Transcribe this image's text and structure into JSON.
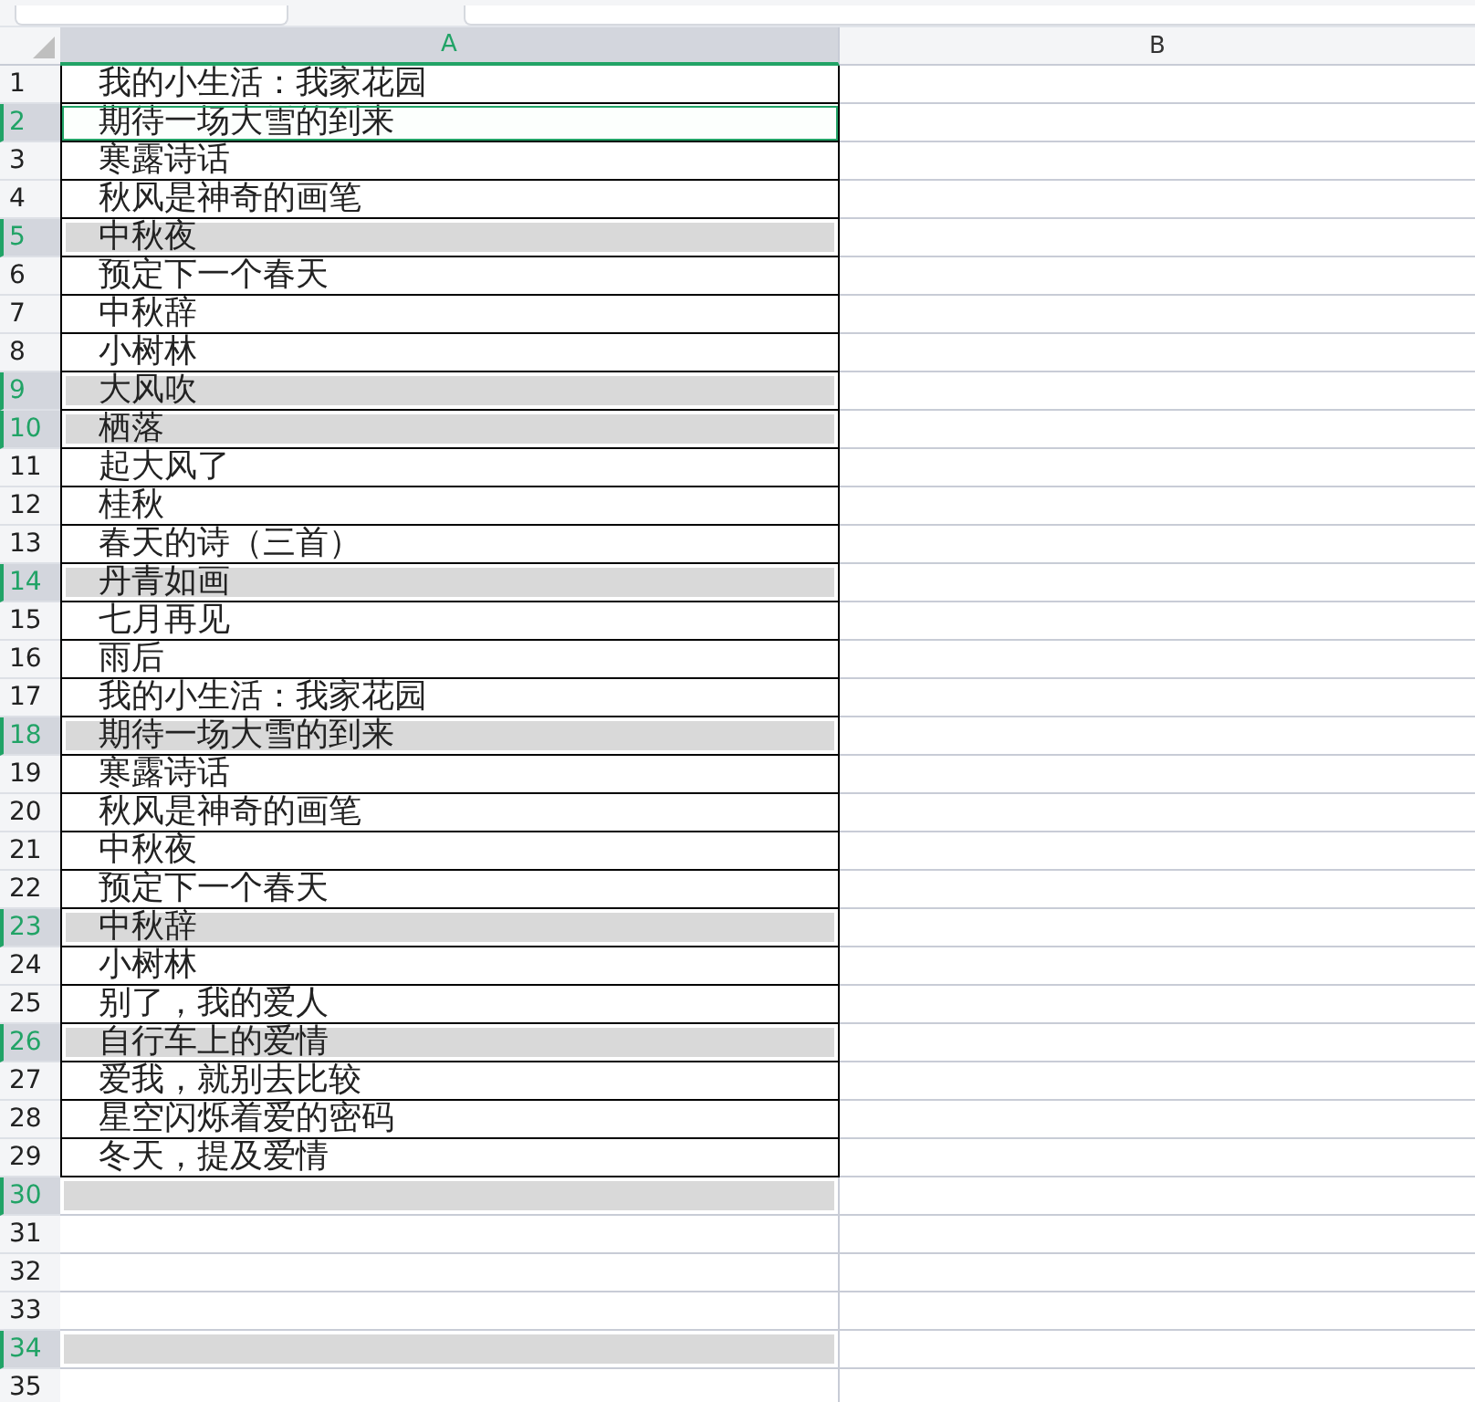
{
  "columns": [
    {
      "label": "A",
      "selected": true
    },
    {
      "label": "B",
      "selected": false
    }
  ],
  "rows": [
    {
      "number": "1",
      "text": "我的小生活：我家花园",
      "selected": false,
      "active": false
    },
    {
      "number": "2",
      "text": "期待一场大雪的到来",
      "selected": true,
      "active": true
    },
    {
      "number": "3",
      "text": "寒露诗话",
      "selected": false,
      "active": false
    },
    {
      "number": "4",
      "text": "秋风是神奇的画笔",
      "selected": false,
      "active": false
    },
    {
      "number": "5",
      "text": "中秋夜",
      "selected": true,
      "active": false
    },
    {
      "number": "6",
      "text": "预定下一个春天",
      "selected": false,
      "active": false
    },
    {
      "number": "7",
      "text": "中秋辞",
      "selected": false,
      "active": false
    },
    {
      "number": "8",
      "text": "小树林",
      "selected": false,
      "active": false
    },
    {
      "number": "9",
      "text": "大风吹",
      "selected": true,
      "active": false
    },
    {
      "number": "10",
      "text": "栖落",
      "selected": true,
      "active": false
    },
    {
      "number": "11",
      "text": "起大风了",
      "selected": false,
      "active": false
    },
    {
      "number": "12",
      "text": "桂秋",
      "selected": false,
      "active": false
    },
    {
      "number": "13",
      "text": "春天的诗（三首）",
      "selected": false,
      "active": false
    },
    {
      "number": "14",
      "text": "丹青如画",
      "selected": true,
      "active": false
    },
    {
      "number": "15",
      "text": "七月再见",
      "selected": false,
      "active": false
    },
    {
      "number": "16",
      "text": "雨后",
      "selected": false,
      "active": false
    },
    {
      "number": "17",
      "text": "我的小生活：我家花园",
      "selected": false,
      "active": false
    },
    {
      "number": "18",
      "text": "期待一场大雪的到来",
      "selected": true,
      "active": false
    },
    {
      "number": "19",
      "text": "寒露诗话",
      "selected": false,
      "active": false
    },
    {
      "number": "20",
      "text": "秋风是神奇的画笔",
      "selected": false,
      "active": false
    },
    {
      "number": "21",
      "text": "中秋夜",
      "selected": false,
      "active": false
    },
    {
      "number": "22",
      "text": "预定下一个春天",
      "selected": false,
      "active": false
    },
    {
      "number": "23",
      "text": "中秋辞",
      "selected": true,
      "active": false
    },
    {
      "number": "24",
      "text": "小树林",
      "selected": false,
      "active": false
    },
    {
      "number": "25",
      "text": "别了，我的爱人",
      "selected": false,
      "active": false
    },
    {
      "number": "26",
      "text": "自行车上的爱情",
      "selected": true,
      "active": false
    },
    {
      "number": "27",
      "text": "爱我，就别去比较",
      "selected": false,
      "active": false
    },
    {
      "number": "28",
      "text": "星空闪烁着爱的密码",
      "selected": false,
      "active": false
    },
    {
      "number": "29",
      "text": "冬天，提及爱情",
      "selected": false,
      "active": false
    },
    {
      "number": "30",
      "selected": true,
      "active": false
    },
    {
      "number": "31",
      "selected": false,
      "active": false
    },
    {
      "number": "32",
      "selected": false,
      "active": false
    },
    {
      "number": "33",
      "selected": false,
      "active": false
    },
    {
      "number": "34",
      "selected": true,
      "active": false
    },
    {
      "number": "35",
      "selected": false,
      "active": false
    }
  ]
}
